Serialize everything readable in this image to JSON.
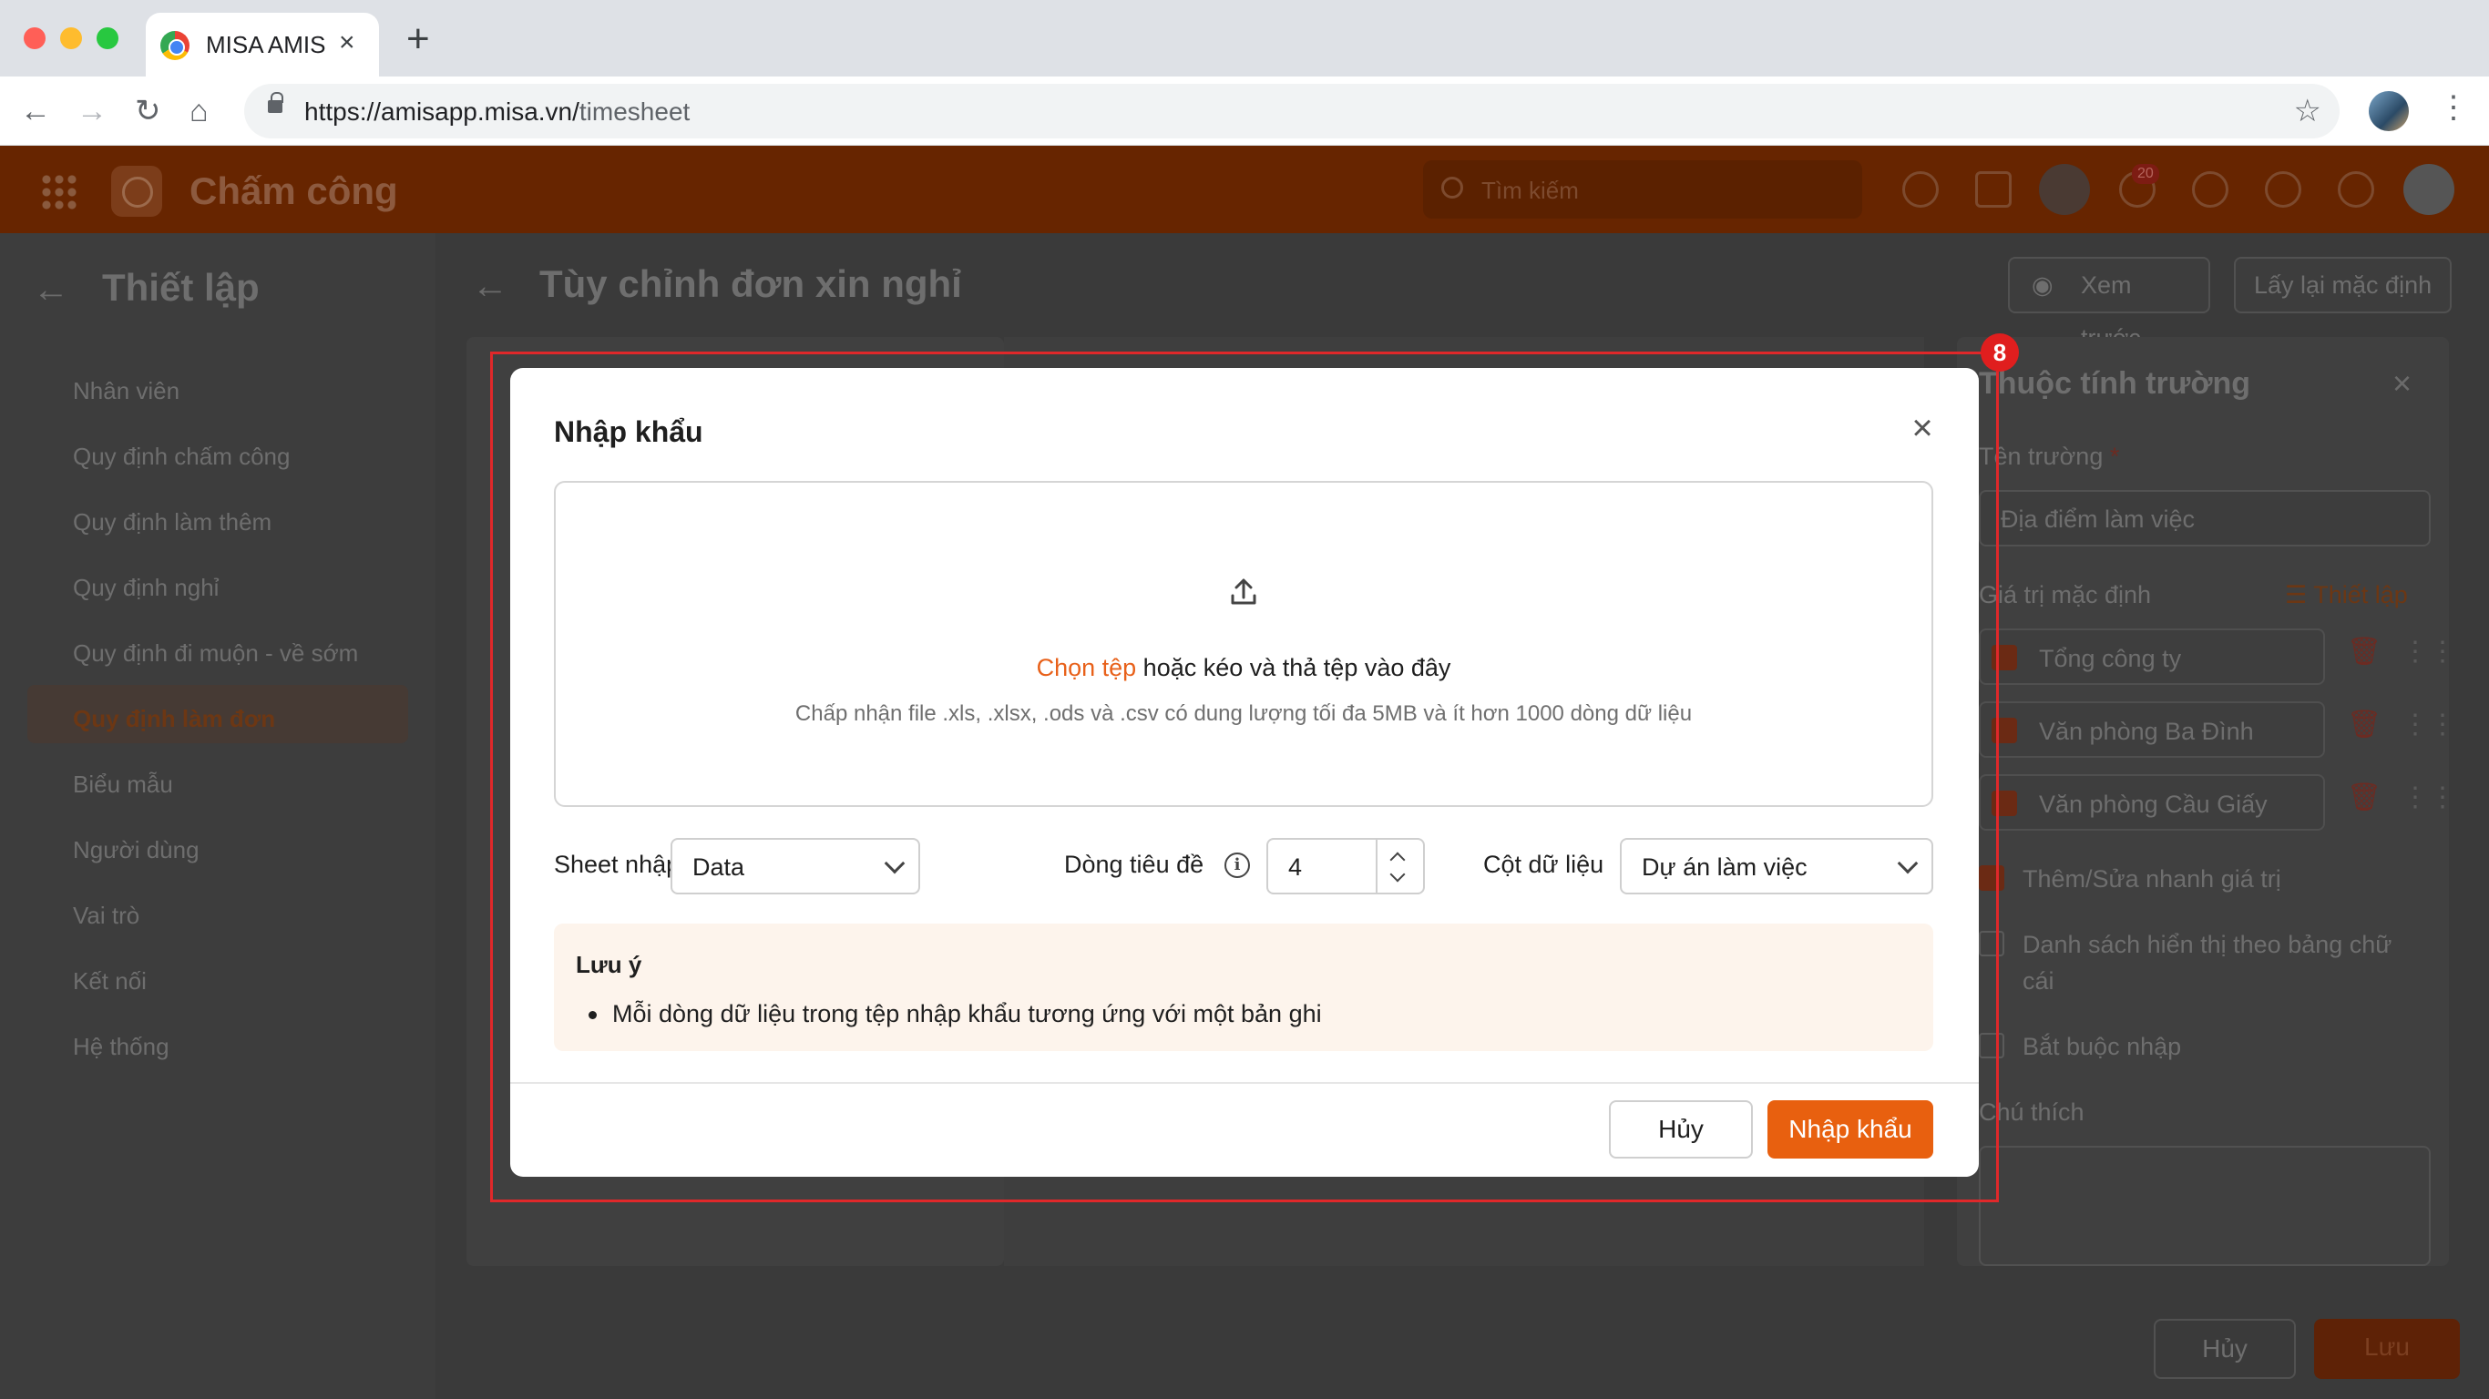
{
  "browser": {
    "tab_title": "MISA AMIS",
    "url_host": "https://amisapp.misa.vn/",
    "url_path": "timesheet"
  },
  "app": {
    "title": "Chấm công",
    "search_placeholder": "Tìm kiếm",
    "notification_count": "20"
  },
  "sidebar": {
    "title": "Thiết lập",
    "items": [
      {
        "label": "Nhân viên"
      },
      {
        "label": "Quy định chấm công"
      },
      {
        "label": "Quy định làm thêm"
      },
      {
        "label": "Quy định nghỉ"
      },
      {
        "label": "Quy định đi muộn - về sớm"
      },
      {
        "label": "Quy định làm đơn"
      },
      {
        "label": "Biểu mẫu"
      },
      {
        "label": "Người dùng"
      },
      {
        "label": "Vai trò"
      },
      {
        "label": "Kết nối"
      },
      {
        "label": "Hệ thống"
      }
    ],
    "active_index": 5
  },
  "main": {
    "title": "Tùy chỉnh đơn xin nghỉ",
    "preview_label": "Xem trước",
    "reset_label": "Lấy lại mặc định",
    "footer_cancel": "Hủy",
    "footer_save": "Lưu"
  },
  "properties": {
    "title": "Thuộc tính trường",
    "field_name_label": "Tên trường",
    "required_mark": "*",
    "field_name_value": "Địa điểm làm việc",
    "default_value_label": "Giá trị mặc định",
    "setup_link": "Thiết lập",
    "options": [
      {
        "label": "Tổng công ty"
      },
      {
        "label": "Văn phòng Ba Đình"
      },
      {
        "label": "Văn phòng Cầu Giấy"
      }
    ],
    "quick_edit_label": "Thêm/Sửa nhanh giá trị",
    "alpha_sort_label_1": "Danh sách hiển thị theo bảng chữ",
    "alpha_sort_label_2": "cái",
    "required_label": "Bắt buộc nhập",
    "note_label": "Chú thích"
  },
  "highlight_badge": "8",
  "modal": {
    "title": "Nhập khẩu",
    "choose_file": "Chọn tệp",
    "drag_text": " hoặc kéo và thả tệp vào đây",
    "hint": "Chấp nhận file .xls, .xlsx, .ods và .csv có dung lượng tối đa 5MB và ít hơn 1000 dòng dữ liệu",
    "sheet_label": "Sheet nhập khẩu",
    "sheet_value": "Data",
    "header_row_label": "Dòng tiêu đề",
    "header_row_value": "4",
    "column_label": "Cột dữ liệu",
    "column_value": "Dự án làm việc",
    "note_title": "Lưu ý",
    "note_item": "Mỗi dòng dữ liệu trong tệp nhập khẩu tương ứng với một bản ghi",
    "cancel_label": "Hủy",
    "import_label": "Nhập khẩu"
  },
  "colors": {
    "accent": "#e8600f",
    "highlight": "#e0282a",
    "note_bg": "#fdf4ec"
  }
}
